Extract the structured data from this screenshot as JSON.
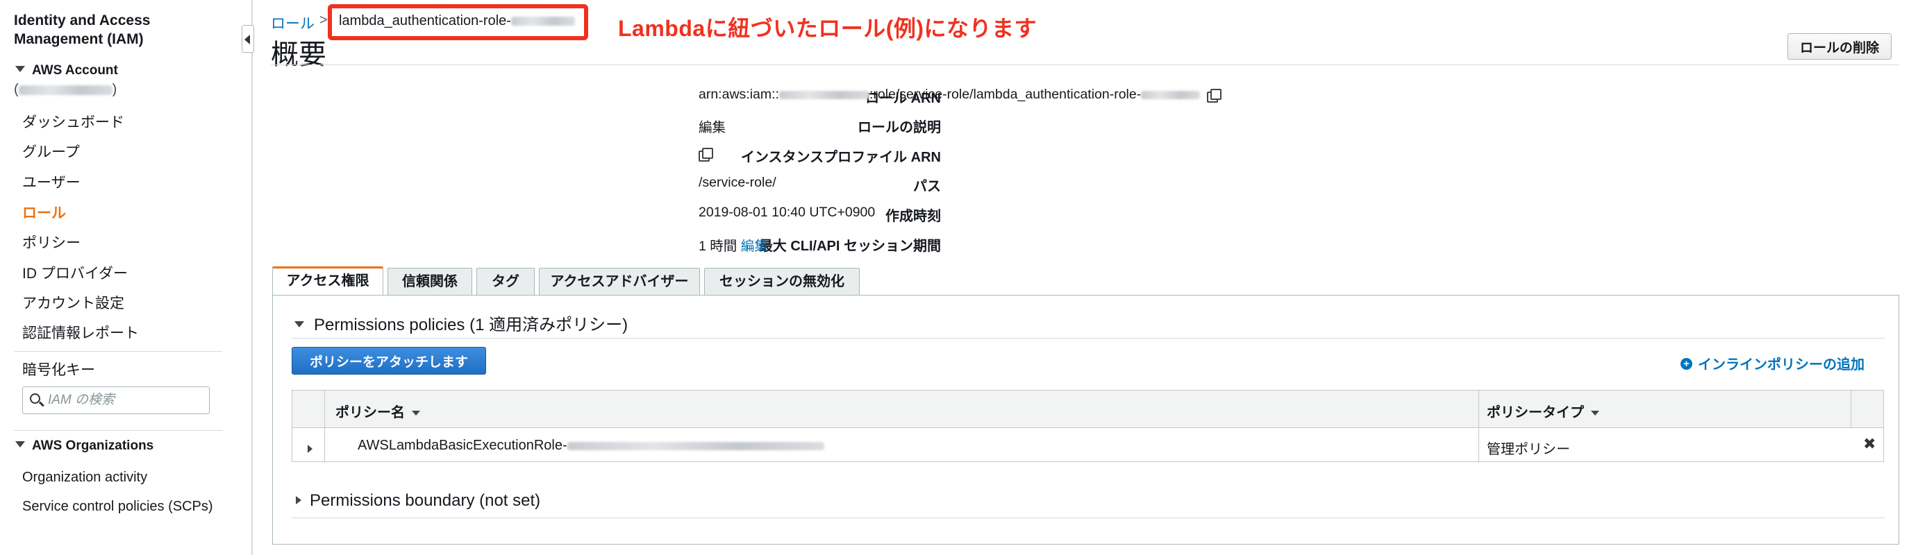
{
  "sidebar": {
    "title_line1": "Identity and Access",
    "title_line2": "Management (IAM)",
    "account_header": "AWS Account",
    "items": [
      {
        "label": "ダッシュボード"
      },
      {
        "label": "グループ"
      },
      {
        "label": "ユーザー"
      },
      {
        "label": "ロール"
      },
      {
        "label": "ポリシー"
      },
      {
        "label": "ID プロバイダー"
      },
      {
        "label": "アカウント設定"
      },
      {
        "label": "認証情報レポート"
      }
    ],
    "encryption_keys": "暗号化キー",
    "search_placeholder": "IAM の検索",
    "org_header": "AWS Organizations",
    "org_items": [
      {
        "label": "Organization activity"
      },
      {
        "label": "Service control policies (SCPs)"
      }
    ]
  },
  "breadcrumb": {
    "parent": "ロール",
    "separator": ">",
    "current": "lambda_authentication-role-"
  },
  "annotation": "Lambdaに紐づいたロール(例)になります",
  "page_title": "概要",
  "delete_button": "ロールの削除",
  "summary": {
    "arn_label": "ロール ARN",
    "arn_prefix": "arn:aws:iam::",
    "arn_suffix": ":role/service-role/lambda_authentication-role-",
    "desc_label": "ロールの説明",
    "desc_link": "編集",
    "instance_label": "インスタンスプロファイル ARN",
    "path_label": "パス",
    "path_value": "/service-role/",
    "created_label": "作成時刻",
    "created_value": "2019-08-01 10:40 UTC+0900",
    "session_label": "最大 CLI/API セッション期間",
    "session_value": "1 時間",
    "session_link": "編集"
  },
  "tabs": [
    {
      "label": "アクセス権限"
    },
    {
      "label": "信頼関係"
    },
    {
      "label": "タグ"
    },
    {
      "label": "アクセスアドバイザー"
    },
    {
      "label": "セッションの無効化"
    }
  ],
  "permissions": {
    "header": "Permissions policies (1 適用済みポリシー)",
    "attach_button": "ポリシーをアタッチします",
    "inline_add": "インラインポリシーの追加",
    "columns": {
      "name": "ポリシー名",
      "type": "ポリシータイプ"
    },
    "rows": [
      {
        "name": "AWSLambdaBasicExecutionRole-",
        "type": "管理ポリシー"
      }
    ],
    "remove_glyph": "✖"
  },
  "boundary_header": "Permissions boundary (not set)"
}
